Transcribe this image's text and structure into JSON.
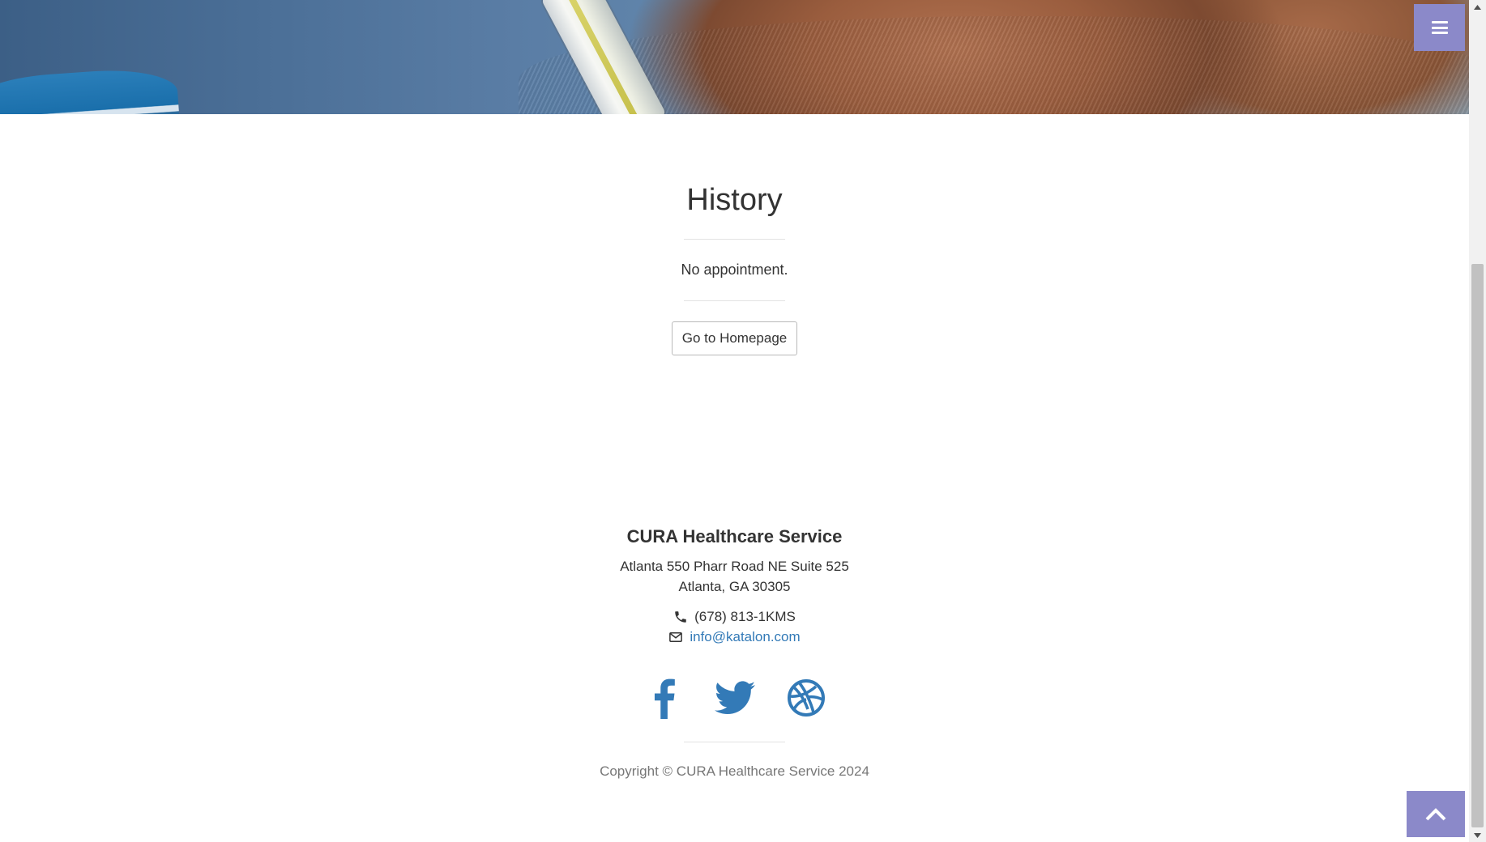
{
  "history": {
    "title": "History",
    "empty_message": "No appointment.",
    "home_button_label": "Go to Homepage"
  },
  "footer": {
    "company": "CURA Healthcare Service",
    "address_line1": "Atlanta 550 Pharr Road NE Suite 525",
    "address_line2": "Atlanta, GA 30305",
    "phone": "(678) 813-1KMS",
    "email": "info@katalon.com",
    "social": [
      "facebook-icon",
      "twitter-icon",
      "dribbble-icon"
    ],
    "copyright": "Copyright © CURA Healthcare Service 2024"
  },
  "colors": {
    "accent": "#8b89c9",
    "link": "#337ab7",
    "text": "#333333",
    "muted": "#777777"
  }
}
